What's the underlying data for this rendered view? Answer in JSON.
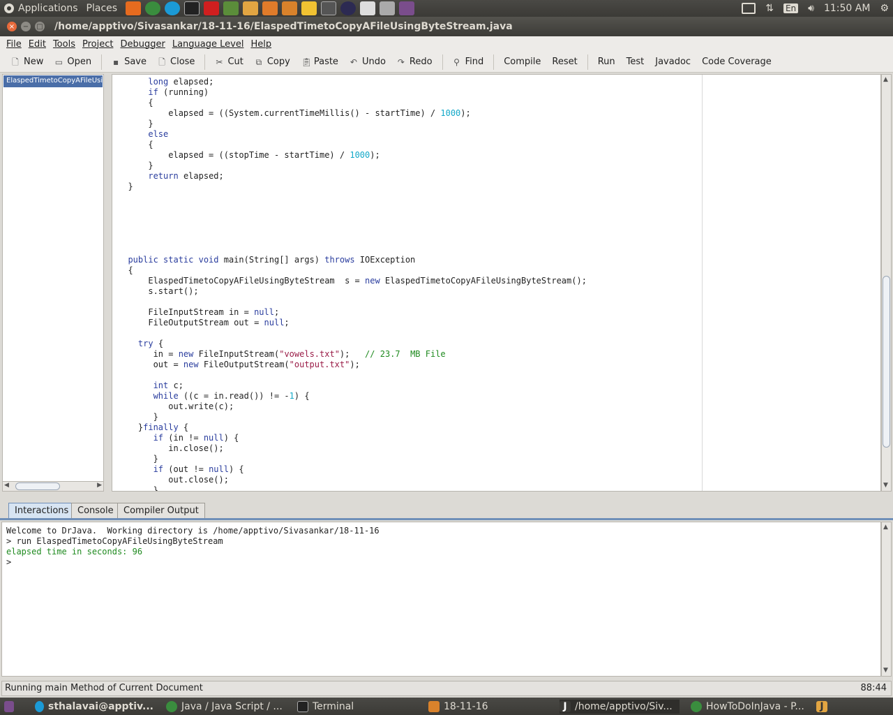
{
  "top_panel": {
    "applications": "Applications",
    "places": "Places",
    "time": "11:50 AM",
    "keyboard": "En"
  },
  "window": {
    "title": "/home/apptivo/Sivasankar/18-11-16/ElaspedTimetoCopyAFileUsingByteStream.java"
  },
  "menubar": [
    "File",
    "Edit",
    "Tools",
    "Project",
    "Debugger",
    "Language Level",
    "Help"
  ],
  "toolbar": {
    "new": "New",
    "open": "Open",
    "save": "Save",
    "close": "Close",
    "cut": "Cut",
    "copy": "Copy",
    "paste": "Paste",
    "undo": "Undo",
    "redo": "Redo",
    "find": "Find",
    "compile": "Compile",
    "reset": "Reset",
    "run": "Run",
    "test": "Test",
    "javadoc": "Javadoc",
    "coverage": "Code Coverage"
  },
  "file_tree": {
    "selected": "ElaspedTimetoCopyAFileUsingByteStream"
  },
  "tabs": {
    "interactions": "Interactions",
    "console": "Console",
    "compiler": "Compiler Output"
  },
  "interactions": {
    "line1": "Welcome to DrJava.  Working directory is /home/apptivo/Sivasankar/18-11-16",
    "line2": "> run ElaspedTimetoCopyAFileUsingByteStream",
    "line3": "elapsed time in seconds: 96",
    "line4": ">"
  },
  "status": {
    "message": "Running main Method of Current Document",
    "position": "88:44"
  },
  "taskbar": {
    "skype": "sthalavai@apptiv...",
    "chrome": "Java / Java Script / ...",
    "terminal": "Terminal",
    "folder": "18-11-16",
    "drjava": "/home/apptivo/Siv...",
    "browser": "HowToDoInJava - P..."
  }
}
